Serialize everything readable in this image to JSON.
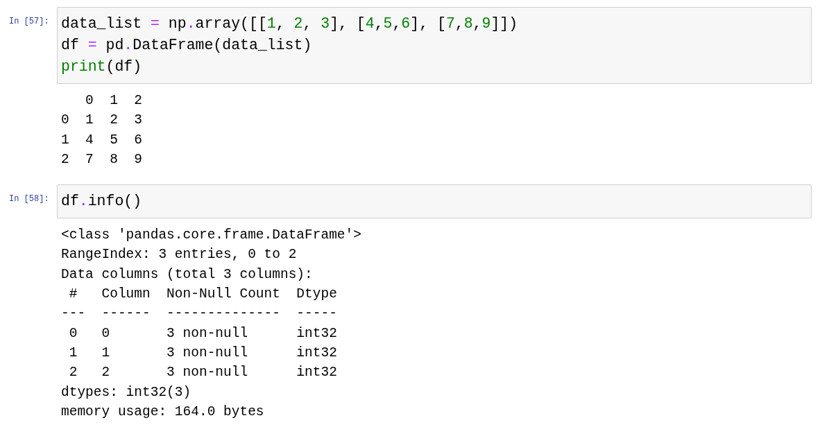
{
  "cells": [
    {
      "prompt": "In [57]:",
      "code": [
        [
          {
            "kind": "name",
            "text": "data_list "
          },
          {
            "kind": "op",
            "text": "="
          },
          {
            "kind": "name",
            "text": " np"
          },
          {
            "kind": "op",
            "text": "."
          },
          {
            "kind": "name",
            "text": "array([["
          },
          {
            "kind": "num",
            "text": "1"
          },
          {
            "kind": "name",
            "text": ", "
          },
          {
            "kind": "num",
            "text": "2"
          },
          {
            "kind": "name",
            "text": ", "
          },
          {
            "kind": "num",
            "text": "3"
          },
          {
            "kind": "name",
            "text": "], ["
          },
          {
            "kind": "num",
            "text": "4"
          },
          {
            "kind": "name",
            "text": ","
          },
          {
            "kind": "num",
            "text": "5"
          },
          {
            "kind": "name",
            "text": ","
          },
          {
            "kind": "num",
            "text": "6"
          },
          {
            "kind": "name",
            "text": "], ["
          },
          {
            "kind": "num",
            "text": "7"
          },
          {
            "kind": "name",
            "text": ","
          },
          {
            "kind": "num",
            "text": "8"
          },
          {
            "kind": "name",
            "text": ","
          },
          {
            "kind": "num",
            "text": "9"
          },
          {
            "kind": "name",
            "text": "]])"
          }
        ],
        [
          {
            "kind": "name",
            "text": "df "
          },
          {
            "kind": "op",
            "text": "="
          },
          {
            "kind": "name",
            "text": " pd"
          },
          {
            "kind": "op",
            "text": "."
          },
          {
            "kind": "name",
            "text": "DataFrame(data_list)"
          }
        ],
        [
          {
            "kind": "builtin",
            "text": "print"
          },
          {
            "kind": "name",
            "text": "(df)"
          }
        ]
      ],
      "output": [
        "   0  1  2",
        "0  1  2  3",
        "1  4  5  6",
        "2  7  8  9"
      ]
    },
    {
      "prompt": "In [58]:",
      "code": [
        [
          {
            "kind": "name",
            "text": "df"
          },
          {
            "kind": "op",
            "text": "."
          },
          {
            "kind": "name",
            "text": "info()"
          }
        ]
      ],
      "output": [
        "<class 'pandas.core.frame.DataFrame'>",
        "RangeIndex: 3 entries, 0 to 2",
        "Data columns (total 3 columns):",
        " #   Column  Non-Null Count  Dtype",
        "---  ------  --------------  -----",
        " 0   0       3 non-null      int32",
        " 1   1       3 non-null      int32",
        " 2   2       3 non-null      int32",
        "dtypes: int32(3)",
        "memory usage: 164.0 bytes"
      ]
    }
  ]
}
